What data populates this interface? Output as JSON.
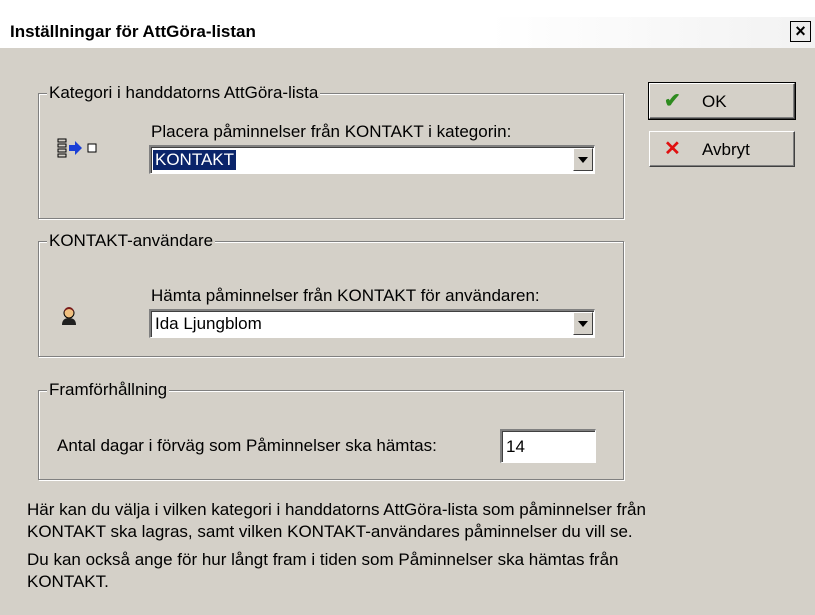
{
  "window": {
    "title": "Inställningar för AttGöra-listan",
    "close_label": "×"
  },
  "category_group": {
    "legend": "Kategori i handdatorns AttGöra-lista",
    "label": "Placera påminnelser från KONTAKT i kategorin:",
    "selected": "KONTAKT",
    "icon": "list-to-category-icon"
  },
  "user_group": {
    "legend": "KONTAKT-användare",
    "label": "Hämta påminnelser från KONTAKT för användaren:",
    "selected": "Ida Ljungblom",
    "icon": "user-avatar-icon"
  },
  "lead_group": {
    "legend": "Framförhållning",
    "label": "Antal dagar i förväg som Påminnelser ska hämtas:",
    "value": "14"
  },
  "buttons": {
    "ok": "OK",
    "cancel": "Avbryt"
  },
  "help": {
    "line1": "Här kan du välja i vilken kategori i handdatorns AttGöra-lista som påminnelser från",
    "line2": "KONTAKT ska lagras, samt vilken KONTAKT-användares påminnelser du vill se.",
    "line3": "Du kan också ange för hur långt fram i tiden som Påminnelser ska hämtas från",
    "line4": "KONTAKT."
  },
  "colors": {
    "dialog_bg": "#d4d0c8",
    "selection": "#0a246a",
    "ok_check": "#2e8b1f",
    "cancel_x": "#e01010"
  }
}
